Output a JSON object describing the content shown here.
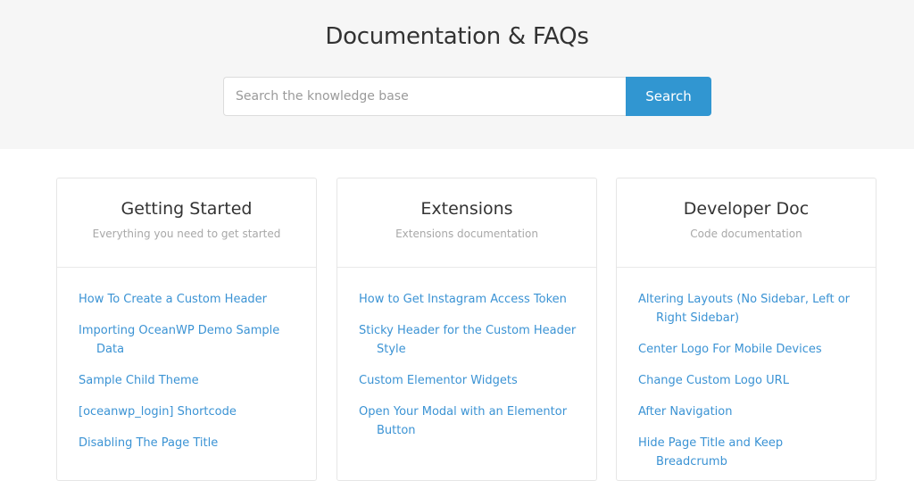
{
  "hero": {
    "title": "Documentation & FAQs",
    "search": {
      "placeholder": "Search the knowledge base",
      "value": "",
      "button_label": "Search"
    }
  },
  "colors": {
    "accent": "#3196d1",
    "link": "#3b93d4",
    "hero_background": "#f6f6f6"
  },
  "categories": [
    {
      "title": "Getting Started",
      "description": "Everything you need to get started",
      "articles": [
        "How To Create a Custom Header",
        "Importing OceanWP Demo Sample Data",
        "Sample Child Theme",
        "[oceanwp_login] Shortcode",
        "Disabling The Page Title"
      ]
    },
    {
      "title": "Extensions",
      "description": "Extensions documentation",
      "articles": [
        "How to Get Instagram Access Token",
        "Sticky Header for the Custom Header Style",
        "Custom Elementor Widgets",
        "Open Your Modal with an Elementor Button"
      ]
    },
    {
      "title": "Developer Doc",
      "description": "Code documentation",
      "articles": [
        "Altering Layouts (No Sidebar, Left or Right Sidebar)",
        "Center Logo For Mobile Devices",
        "Change Custom Logo URL",
        "After Navigation",
        "Hide Page Title and Keep Breadcrumb"
      ]
    }
  ]
}
